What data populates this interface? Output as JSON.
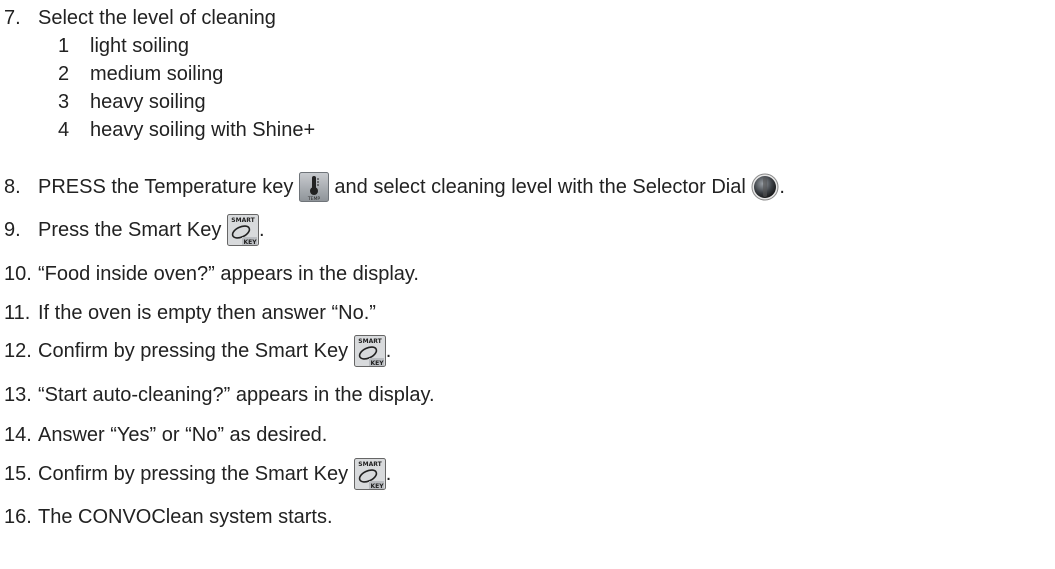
{
  "steps": {
    "s7": {
      "num": "7.",
      "text": "Select the level of cleaning"
    },
    "levels": [
      {
        "num": "1",
        "text": "light soiling"
      },
      {
        "num": "2",
        "text": "medium soiling"
      },
      {
        "num": "3",
        "text": "heavy soiling"
      },
      {
        "num": "4",
        "text": "heavy soiling with Shine+"
      }
    ],
    "s8": {
      "num": "8.",
      "text_a": "PRESS the Temperature key ",
      "text_b": " and select cleaning level with the Selector Dial ",
      "text_c": "."
    },
    "s9": {
      "num": "9.",
      "text_a": "Press the Smart Key ",
      "text_b": "."
    },
    "s10": {
      "num": "10.",
      "text": "“Food inside oven?” appears in the display."
    },
    "s11": {
      "num": "11.",
      "text": "If the oven is empty then answer “No.”"
    },
    "s12": {
      "num": "12.",
      "text_a": "Confirm by pressing the Smart Key ",
      "text_b": "."
    },
    "s13": {
      "num": "13.",
      "text": "“Start auto-cleaning?” appears in the display."
    },
    "s14": {
      "num": "14.",
      "text": "Answer “Yes” or “No” as desired."
    },
    "s15": {
      "num": "15.",
      "text_a": "Confirm by pressing the Smart Key ",
      "text_b": "."
    },
    "s16": {
      "num": "16.",
      "text": "The CONVOClean system starts."
    }
  },
  "icons": {
    "temp_key": {
      "icon": "temperature-key-icon",
      "label": "TEMP"
    },
    "smart_key": {
      "icon": "smart-key-icon",
      "label_top": "SMART",
      "label_bottom": "KEY"
    },
    "selector_dial": {
      "icon": "selector-dial-icon"
    }
  }
}
